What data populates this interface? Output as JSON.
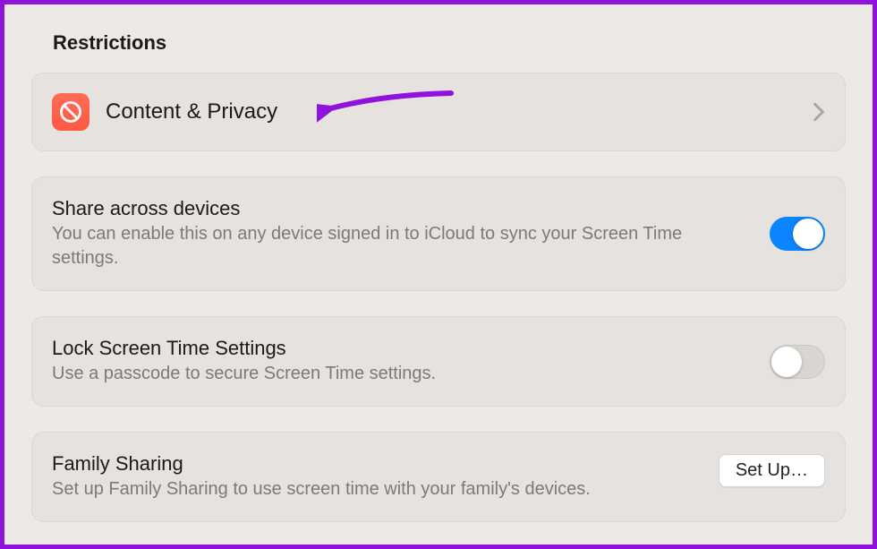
{
  "section_header": "Restrictions",
  "content_privacy": {
    "label": "Content & Privacy"
  },
  "share_devices": {
    "title": "Share across devices",
    "desc": "You can enable this on any device signed in to iCloud to sync your Screen Time settings.",
    "toggle_state": "on"
  },
  "lock_settings": {
    "title": "Lock Screen Time Settings",
    "desc": "Use a passcode to secure Screen Time settings.",
    "toggle_state": "off"
  },
  "family_sharing": {
    "title": "Family Sharing",
    "desc": "Set up Family Sharing to use screen time with your family's devices.",
    "button_label": "Set Up…"
  },
  "colors": {
    "accent": "#0b84ff",
    "annotation": "#9013dd",
    "icon_bg": "#fe5b45"
  }
}
